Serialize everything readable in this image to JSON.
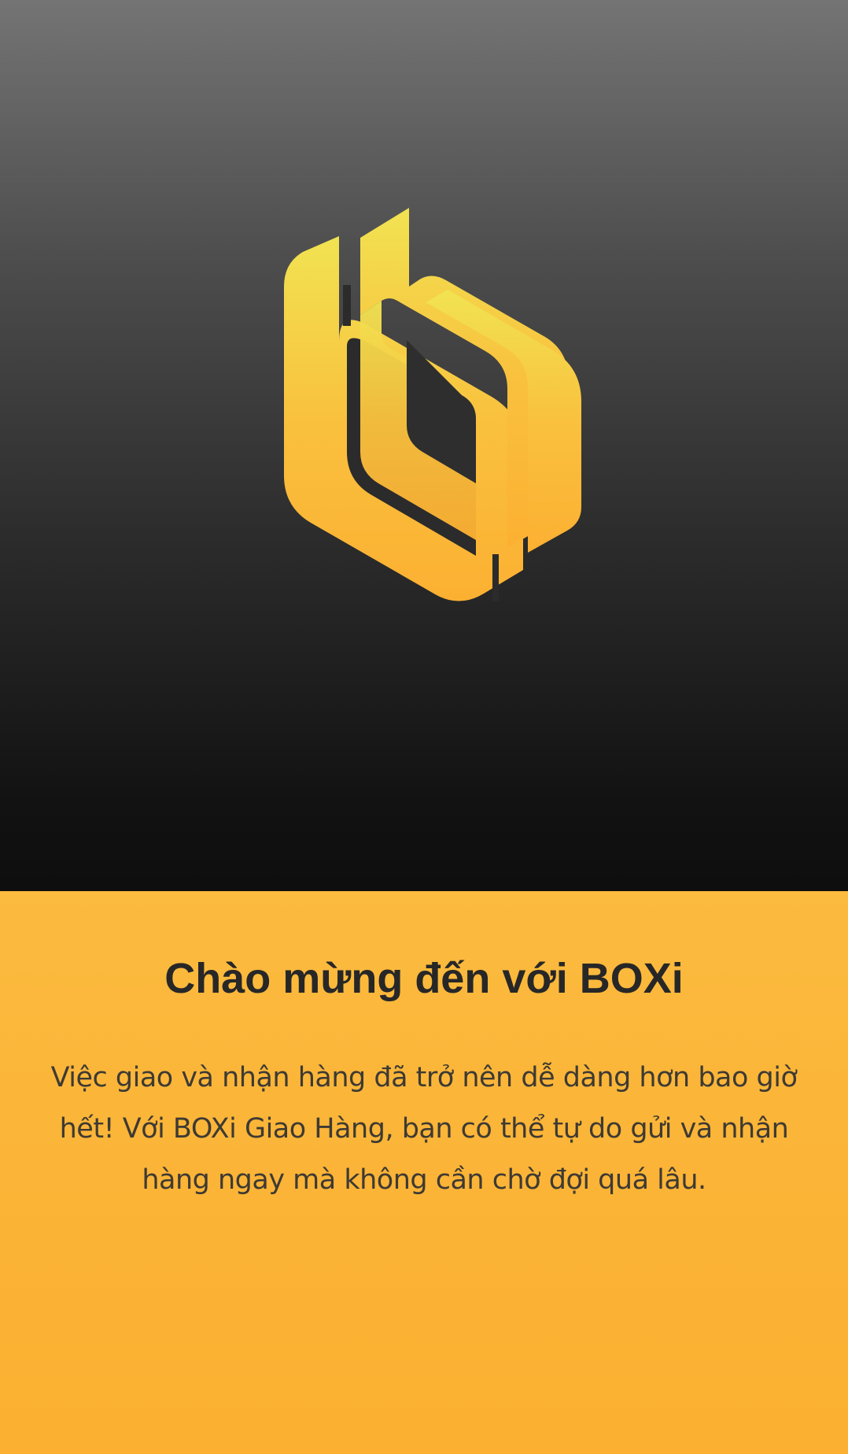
{
  "hero": {
    "logo_icon": "boxi-logo-icon",
    "colors": {
      "background_top": "#747474",
      "background_bottom": "#0e0e0e",
      "logo_top": "#f1e150",
      "logo_bottom": "#fcb132"
    }
  },
  "welcome": {
    "title": "Chào mừng đến với BOXi",
    "description": "Việc giao và nhận hàng đã trở nên dễ dàng hơn bao giờ hết! Với BOXi Giao Hàng, bạn có thể tự do gửi và nhận hàng ngay mà không cần chờ đợi quá lâu.",
    "colors": {
      "panel": "#fbb437",
      "title_text": "#272727",
      "body_text": "#3e3a33"
    }
  }
}
